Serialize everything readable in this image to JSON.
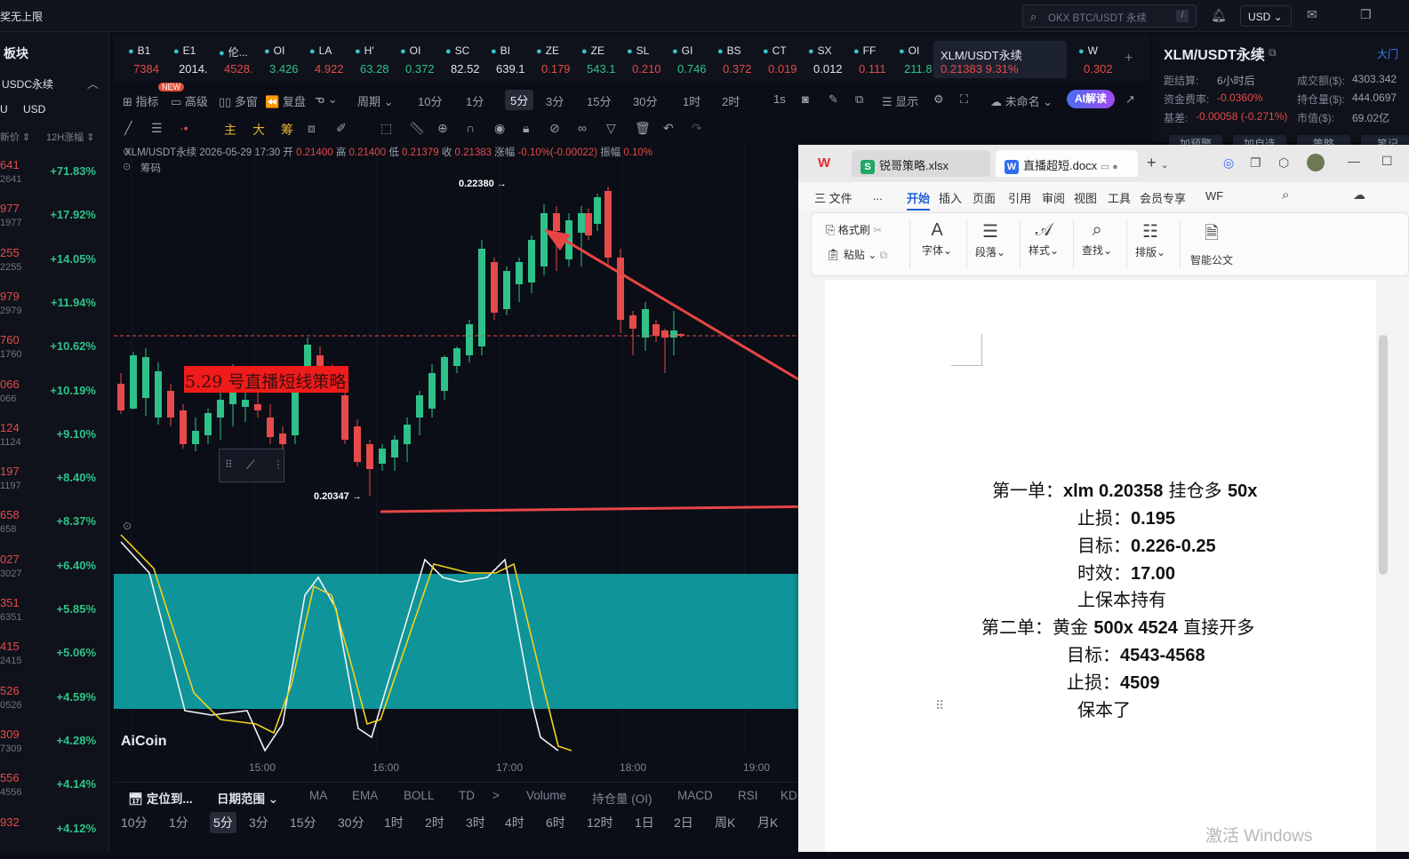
{
  "app": {
    "title": "奖无上限"
  },
  "topbar": {
    "search_placeholder": "OKX BTC/USDT 永续",
    "search_slash": "/",
    "currency": "USD"
  },
  "left_panel": {
    "title": "板块",
    "sub1": "USDC永续",
    "sub2a": "U",
    "sub2b": "USD",
    "col_price": "新价 ⇕",
    "col_change": "12H涨幅 ⇕",
    "rows": [
      {
        "p1": "641",
        "p2": "2641",
        "chg": "+71.83%"
      },
      {
        "p1": "977",
        "p2": "1977",
        "chg": "+17.92%"
      },
      {
        "p1": "255",
        "p2": "2255",
        "chg": "+14.05%"
      },
      {
        "p1": "979",
        "p2": "2979",
        "chg": "+11.94%"
      },
      {
        "p1": "760",
        "p2": "1760",
        "chg": "+10.62%"
      },
      {
        "p1": "066",
        "p2": "066",
        "chg": "+10.19%"
      },
      {
        "p1": "124",
        "p2": "1124",
        "chg": "+9.10%"
      },
      {
        "p1": "197",
        "p2": "1197",
        "chg": "+8.40%"
      },
      {
        "p1": "658",
        "p2": "658",
        "chg": "+8.37%"
      },
      {
        "p1": "027",
        "p2": "3027",
        "chg": "+6.40%"
      },
      {
        "p1": "351",
        "p2": "6351",
        "chg": "+5.85%"
      },
      {
        "p1": "415",
        "p2": "2415",
        "chg": "+5.06%"
      },
      {
        "p1": "526",
        "p2": "0526",
        "chg": "+4.59%"
      },
      {
        "p1": "309",
        "p2": "7309",
        "chg": "+4.28%"
      },
      {
        "p1": "556",
        "p2": "4556",
        "chg": "+4.14%"
      },
      {
        "p1": "932",
        "p2": "",
        "chg": "+4.12%"
      }
    ]
  },
  "tickers": [
    {
      "name": "B1",
      "price": "7384",
      "color": "#e64a4a"
    },
    {
      "name": "E1",
      "price": "2014.",
      "color": "#dfe3ea"
    },
    {
      "name": "伦...",
      "price": "4528.",
      "color": "#e64a4a"
    },
    {
      "name": "OI",
      "price": "3.426",
      "color": "#2ec28a"
    },
    {
      "name": "LA",
      "price": "4.922",
      "color": "#e64a4a"
    },
    {
      "name": "H'",
      "price": "63.28",
      "color": "#2ec28a"
    },
    {
      "name": "OI",
      "price": "0.372",
      "color": "#2ec28a"
    },
    {
      "name": "SC",
      "price": "82.52",
      "color": "#dfe3ea"
    },
    {
      "name": "BI",
      "price": "639.1",
      "color": "#dfe3ea"
    },
    {
      "name": "ZE",
      "price": "0.179",
      "color": "#e64a4a"
    },
    {
      "name": "ZE",
      "price": "543.1",
      "color": "#2ec28a"
    },
    {
      "name": "SL",
      "price": "0.210",
      "color": "#e64a4a"
    },
    {
      "name": "GI",
      "price": "0.746",
      "color": "#2ec28a"
    },
    {
      "name": "BS",
      "price": "0.372",
      "color": "#e64a4a"
    },
    {
      "name": "CT",
      "price": "0.019",
      "color": "#e64a4a"
    },
    {
      "name": "SX",
      "price": "0.012",
      "color": "#dfe3ea"
    },
    {
      "name": "FF",
      "price": "0.111",
      "color": "#e64a4a"
    },
    {
      "name": "OI",
      "price": "211.8",
      "color": "#2ec28a"
    }
  ],
  "ticker_active": {
    "name": "XLM/USDT永续",
    "price": "0.21383  9.31%"
  },
  "ticker_last": {
    "name": "W",
    "price": "0.302"
  },
  "toolbar1": {
    "indicator": "指标",
    "new_badge": "NEW",
    "advanced": "高级",
    "multi": "多窗",
    "replay": "复盘",
    "period": "周期",
    "intervals": [
      "10分",
      "1分",
      "5分",
      "3分",
      "15分",
      "30分",
      "1时",
      "2时"
    ],
    "active_interval": "5分",
    "one_s": "1s",
    "display": "显示",
    "unnamed": "未命名",
    "ai": "AI解读"
  },
  "toolbar2": {
    "main": "主",
    "big": "大",
    "chip": "筹"
  },
  "chart": {
    "ohlc_prefix": "XLM/USDT永续  2026-05-29 17:30  开",
    "open": "0.21400",
    "high_label": "高",
    "high": "0.21400",
    "low_label": "低",
    "low": "0.21379",
    "close_label": "收",
    "close": "0.21383",
    "amp_label": "涨幅",
    "amp": "-0.10%(-0.00022)",
    "vib_label": "振幅",
    "vib": "0.10%",
    "chip_label": "筹码",
    "high_marker": "0.22380 →",
    "low_marker": "0.20347 →",
    "time_labels": [
      "15:00",
      "16:00",
      "17:00",
      "18:00",
      "19:00"
    ],
    "logo": "AiCoin"
  },
  "bottom1": {
    "locate": "定位到...",
    "range": "日期范围",
    "items": [
      "MA",
      "EMA",
      "BOLL",
      "TD",
      ">",
      "Volume",
      "持仓量 (OI)",
      "MACD",
      "RSI",
      "KD"
    ]
  },
  "bottom2": {
    "items": [
      "10分",
      "1分",
      "5分",
      "3分",
      "15分",
      "30分",
      "1时",
      "2时",
      "3时",
      "4时",
      "6时",
      "12时",
      "1日",
      "2日",
      "周K",
      "月K"
    ],
    "active": "5分"
  },
  "right_panel": {
    "title": "XLM/USDT永续",
    "link": "大门",
    "rows": [
      {
        "l1": "距结算:",
        "v1": "6小时后",
        "l2": "成交额($):",
        "v2": "4303.342"
      },
      {
        "l1": "资金费率:",
        "v1": "-0.0360%",
        "l2": "持仓量($):",
        "v2": "444.0697"
      },
      {
        "l1": "基差:",
        "v1": "-0.00058 (-0.271%)",
        "l2": "市值($):",
        "v2": "69.02亿"
      }
    ],
    "buttons": [
      "加预警",
      "加自选",
      "策略",
      "笔记"
    ]
  },
  "wps": {
    "tab_xlsx": "锐哥策略.xlsx",
    "tab_docx": "直播超短.docx",
    "menu": [
      "三 文件",
      "...",
      "开始",
      "插入",
      "页面",
      "引用",
      "审阅",
      "视图",
      "工具",
      "会员专享",
      "WF"
    ],
    "ribbon": {
      "format_painter": "格式刷",
      "paste": "粘贴",
      "font": "字体",
      "paragraph": "段落",
      "style": "样式",
      "find": "查找",
      "layout": "排版",
      "smart": "智能公文"
    },
    "doc_title": "5.29 号直播短线策略",
    "lines": [
      {
        "a": "第一单：",
        "b": "xlm    0.20358",
        "c": "   挂仓多    ",
        "d": "50x"
      },
      {
        "a": "止损：",
        "b": "0.195",
        "c": "",
        "d": ""
      },
      {
        "a": "目标：",
        "b": "0.226-0.25",
        "c": "",
        "d": ""
      },
      {
        "a": "时效：",
        "b": "17.00",
        "c": "",
        "d": ""
      },
      {
        "a": "上保本持有",
        "b": "",
        "c": "",
        "d": ""
      },
      {
        "a": "第二单：黄金 ",
        "b": "500x   4524",
        "c": "  直接开多",
        "d": ""
      },
      {
        "a": "目标：",
        "b": "4543-4568",
        "c": "",
        "d": ""
      },
      {
        "a": "止损：",
        "b": "4509",
        "c": "",
        "d": ""
      },
      {
        "a": "保本了",
        "b": "",
        "c": "",
        "d": ""
      }
    ]
  },
  "watermark": "激活 Windows"
}
